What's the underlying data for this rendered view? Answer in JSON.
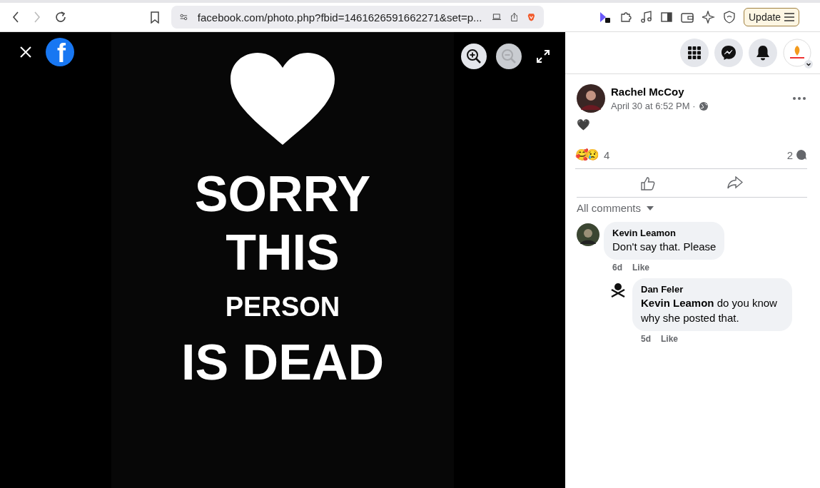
{
  "browser": {
    "url": "facebook.com/photo.php?fbid=1461626591662271&set=p...",
    "update_label": "Update"
  },
  "viewer": {
    "logo": "f",
    "zoom_buttons": [
      {
        "kind": "zoom-in",
        "disabled": false
      },
      {
        "kind": "zoom-out",
        "disabled": true
      }
    ],
    "photo": {
      "lines": [
        {
          "text": "SORRY",
          "kind": "large"
        },
        {
          "text": "THIS",
          "kind": "large"
        },
        {
          "text": "PERSON",
          "kind": "small"
        },
        {
          "text": "IS DEAD",
          "kind": "large"
        }
      ]
    }
  },
  "post": {
    "author": "Rachel McCoy",
    "time": "April 30 at 6:52 PM · ",
    "text": "🖤",
    "reactions": "🥰😢",
    "reaction_count": "4",
    "comment_count": "2"
  },
  "comments_filter": "All comments",
  "comments": [
    {
      "author": "Kevin Leamon",
      "text": "Don't say that. Please",
      "age": "6d",
      "like": "Like",
      "reply": false
    },
    {
      "author": "Dan Feler",
      "text": "**Kevin Leamon** do you know why she posted that.",
      "age": "5d",
      "like": "Like",
      "reply": true
    }
  ]
}
